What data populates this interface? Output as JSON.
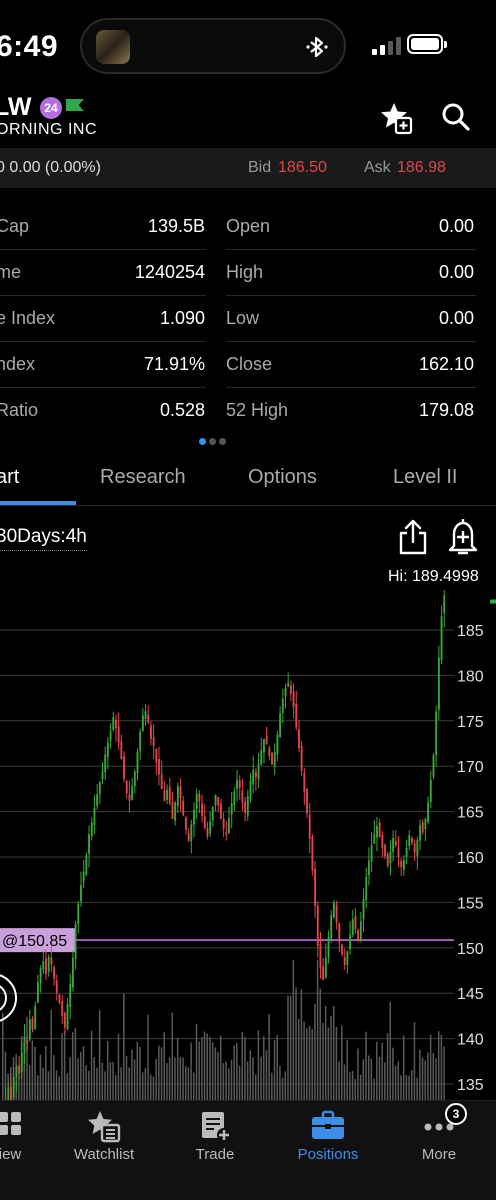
{
  "status_bar": {
    "time": "6:49"
  },
  "header": {
    "symbol": "LW",
    "badge": "24",
    "company": "ORNING INC"
  },
  "quote": {
    "change": "0  0.00 (0.00%)",
    "bid_label": "Bid",
    "bid": "186.50",
    "ask_label": "Ask",
    "ask": "186.98"
  },
  "stats": [
    {
      "label1": "Cap",
      "value1": "139.5B",
      "label2": "Open",
      "value2": "0.00"
    },
    {
      "label1": "me",
      "value1": "1240254",
      "label2": "High",
      "value2": "0.00"
    },
    {
      "label1": "e Index",
      "value1": "1.090",
      "label2": "Low",
      "value2": "0.00"
    },
    {
      "label1": "ndex",
      "value1": "71.91%",
      "label2": "Close",
      "value2": "162.10"
    },
    {
      "label1": "Ratio",
      "value1": "0.528",
      "label2": "52 High",
      "value2": "179.08"
    }
  ],
  "tabs": [
    {
      "label": "art",
      "active": true
    },
    {
      "label": "Research"
    },
    {
      "label": "Options"
    },
    {
      "label": "Level II"
    }
  ],
  "chart_header": {
    "period": "30Days:4h",
    "hi_label": "Hi: 189.4998"
  },
  "chart_data": {
    "type": "candlestick",
    "y_ticks": [
      "185",
      "180",
      "175",
      "170",
      "165",
      "160",
      "155",
      "150",
      "145",
      "140",
      "135"
    ],
    "ylim": [
      133,
      190
    ],
    "hi": 189.4998,
    "marker_label": "@150.85",
    "marker_value": 150.85,
    "colors": {
      "up": "#3aa83a",
      "down": "#e0464a",
      "marker": "#c46be0",
      "grid": "#3a3a3a",
      "volume": "#5a5a5a"
    },
    "closes": [
      131.5,
      133.2,
      134.5,
      133.0,
      135.8,
      137.0,
      136.1,
      138.4,
      140.2,
      139.5,
      142.1,
      141.0,
      143.6,
      146.2,
      147.8,
      148.5,
      147.1,
      149.0,
      148.2,
      146.6,
      145.0,
      143.9,
      142.5,
      141.2,
      143.8,
      146.0,
      148.9,
      152.6,
      154.8,
      156.9,
      158.4,
      160.2,
      162.5,
      163.8,
      165.4,
      166.9,
      168.2,
      169.5,
      171.3,
      172.6,
      173.9,
      175.4,
      174.2,
      172.5,
      170.8,
      168.6,
      167.0,
      166.2,
      167.8,
      169.4,
      171.6,
      173.8,
      175.6,
      176.1,
      174.8,
      173.0,
      172.2,
      170.4,
      169.1,
      167.5,
      166.2,
      167.4,
      165.9,
      164.2,
      166.0,
      167.8,
      166.5,
      164.6,
      163.0,
      161.8,
      163.6,
      165.2,
      167.0,
      166.1,
      164.5,
      163.2,
      162.3,
      163.9,
      165.5,
      166.8,
      165.7,
      164.2,
      163.1,
      162.5,
      164.3,
      165.9,
      167.2,
      168.5,
      167.6,
      166.0,
      164.9,
      166.7,
      168.4,
      169.6,
      168.8,
      170.3,
      171.8,
      173.0,
      172.4,
      171.1,
      170.2,
      171.6,
      173.5,
      175.8,
      177.4,
      178.6,
      179.2,
      178.0,
      176.5,
      174.3,
      172.0,
      169.5,
      167.2,
      164.8,
      162.0,
      158.5,
      154.6,
      150.2,
      147.8,
      146.5,
      148.9,
      151.2,
      153.6,
      155.0,
      152.8,
      150.6,
      149.3,
      148.1,
      149.6,
      151.4,
      153.2,
      152.0,
      150.8,
      152.9,
      155.4,
      157.8,
      159.6,
      161.3,
      162.5,
      163.4,
      162.2,
      161.0,
      160.1,
      159.0,
      160.6,
      162.1,
      161.3,
      160.0,
      158.9,
      159.7,
      161.0,
      162.4,
      161.6,
      160.5,
      161.9,
      163.5,
      162.7,
      164.2,
      166.0,
      168.5,
      171.2,
      176.0,
      182.0,
      186.5,
      188.8
    ]
  },
  "bottom_nav": [
    {
      "label": "iew",
      "icon": "grid-icon"
    },
    {
      "label": "Watchlist",
      "icon": "star-list-icon"
    },
    {
      "label": "Trade",
      "icon": "trade-icon"
    },
    {
      "label": "Positions",
      "icon": "briefcase-icon",
      "active": true
    },
    {
      "label": "More",
      "icon": "more-icon",
      "badge": "3"
    }
  ]
}
